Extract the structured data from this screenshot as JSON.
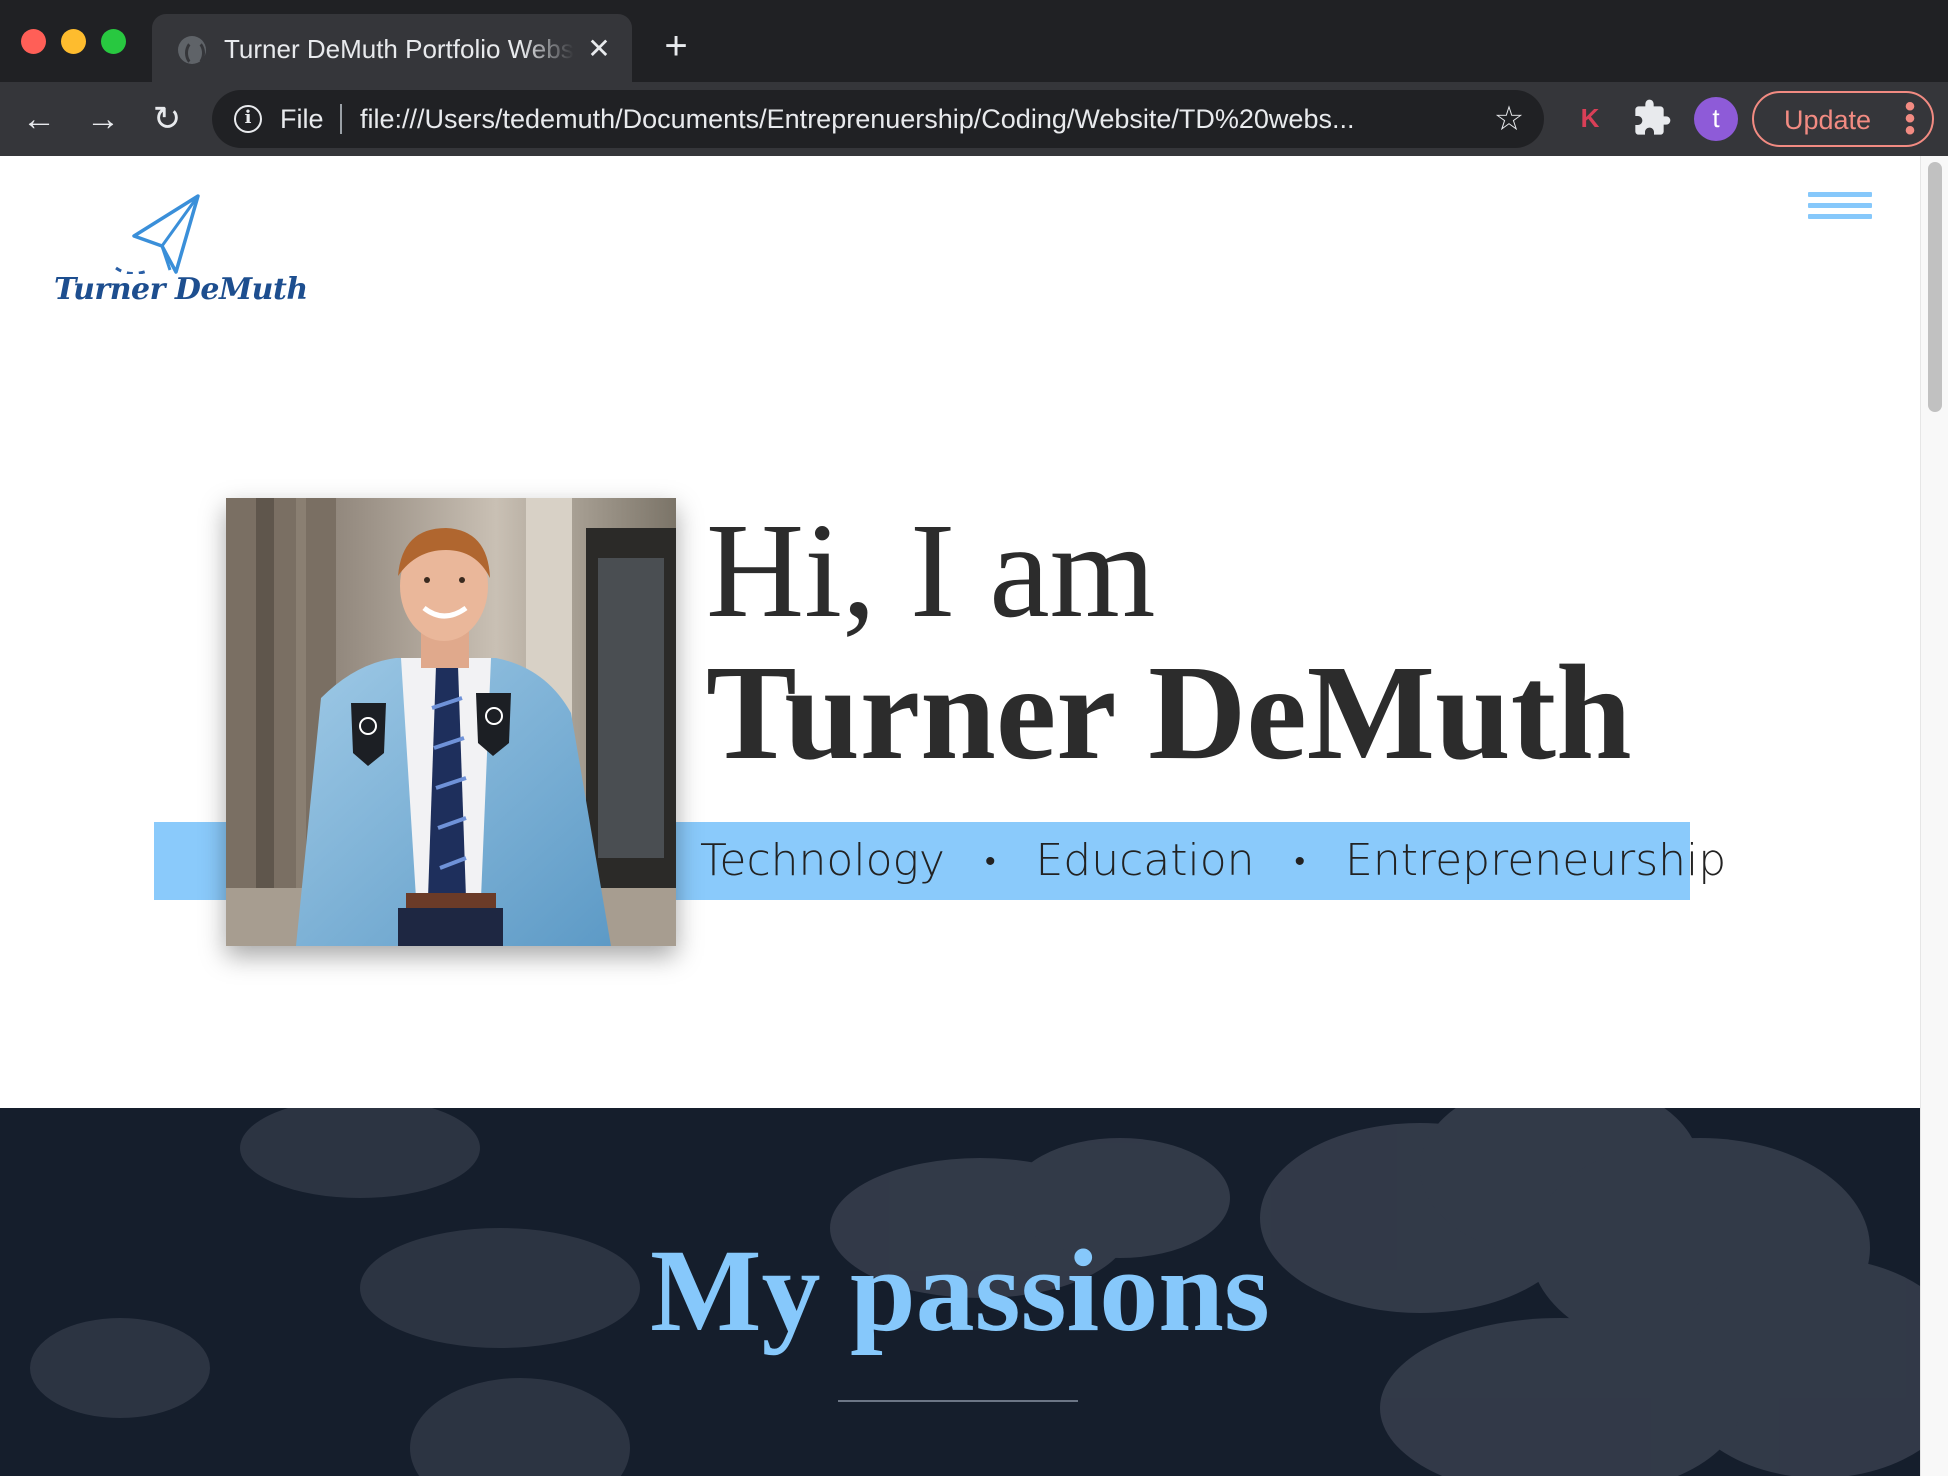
{
  "browser": {
    "tab_title": "Turner DeMuth Portfolio Website",
    "tab_close": "✕",
    "new_tab": "+",
    "nav_back": "←",
    "nav_forward": "→",
    "nav_reload": "↻",
    "scheme_label": "File",
    "url": "file:///Users/tedemuth/Documents/Entreprenuership/Coding/Website/TD%20webs...",
    "extension_k": "K",
    "avatar_initial": "t",
    "update_label": "Update",
    "menu_dots": "⋮",
    "icons": [
      "globe-icon",
      "info-icon",
      "star-icon",
      "puzzle-icon"
    ]
  },
  "page": {
    "logo_text": "Turner DeMuth",
    "hero": {
      "greeting": "Hi, I am",
      "name": "Turner DeMuth",
      "tags": [
        "Technology",
        "Education",
        "Entrepreneurship"
      ],
      "separator": "•"
    },
    "section_title": "My passions",
    "colors": {
      "accent": "#8acafb",
      "heading": "#2c2c2c",
      "logo": "#1d4e8f",
      "section_bg": "#151e2c"
    }
  }
}
